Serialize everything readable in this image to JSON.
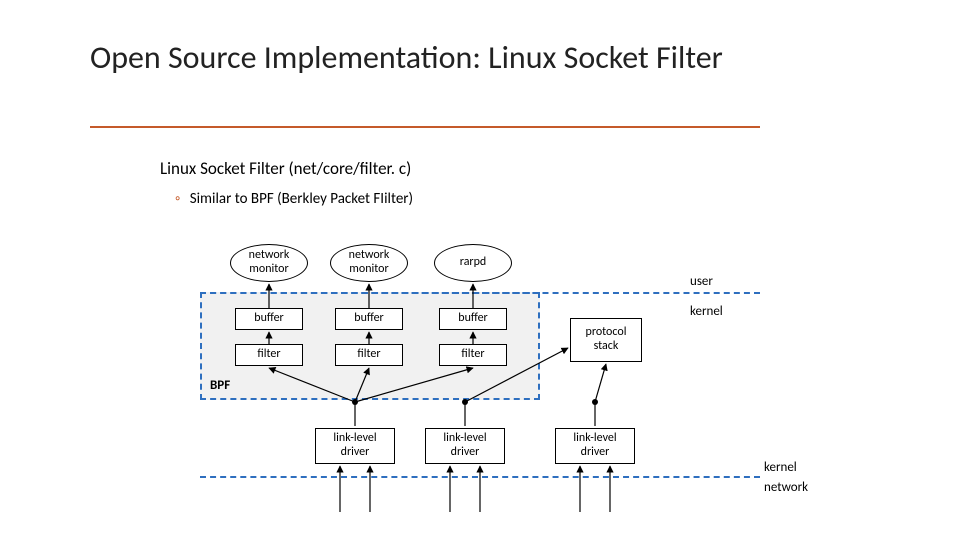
{
  "title": "Open Source Implementation: Linux Socket Filter",
  "subtitle": "Linux Socket Filter (net/core/filter. c)",
  "bullet": "Similar to BPF (Berkley Packet FIilter)",
  "labels": {
    "user": "user",
    "kernel": "kernel",
    "kernel2": "kernel",
    "network": "network",
    "protocol_stack": "protocol\nstack",
    "bpf": "BPF"
  },
  "nodes": {
    "netmon1": "network\nmonitor",
    "netmon2": "network\nmonitor",
    "rarpd": "rarpd",
    "buf1": "buffer",
    "buf2": "buffer",
    "buf3": "buffer",
    "filt1": "filter",
    "filt2": "filter",
    "filt3": "filter",
    "drv1": "link-level\ndriver",
    "drv2": "link-level\ndriver",
    "drv3": "link-level\ndriver"
  }
}
